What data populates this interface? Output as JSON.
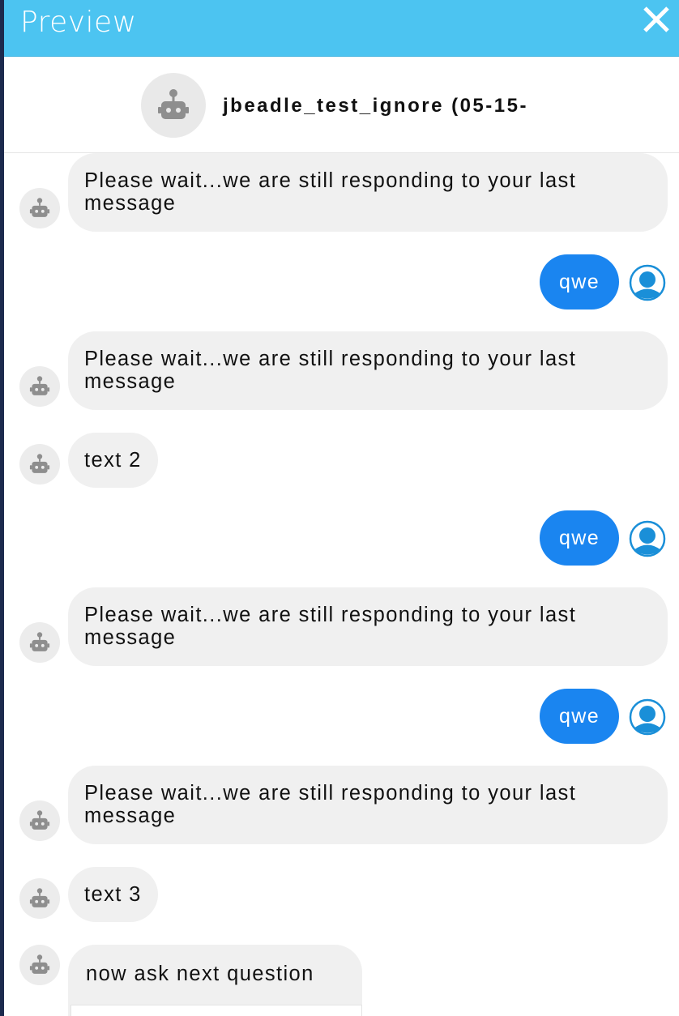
{
  "header": {
    "title": "Preview",
    "close_icon": "close-icon"
  },
  "bot": {
    "name": "jbeadle_test_ignore (05-15-",
    "avatar_icon": "robot-icon"
  },
  "colors": {
    "header_bg": "#4cc4f1",
    "user_bubble": "#1a85f0",
    "bot_bubble": "#f0f0f0",
    "user_avatar": "#1a8fd8"
  },
  "messages": [
    {
      "sender": "bot",
      "text": "Please wait...we are still responding to your last message"
    },
    {
      "sender": "user",
      "text": "qwe"
    },
    {
      "sender": "bot",
      "text": "Please wait...we are still responding to your last message"
    },
    {
      "sender": "bot",
      "text": "text 2"
    },
    {
      "sender": "user",
      "text": "qwe"
    },
    {
      "sender": "bot",
      "text": "Please wait...we are still responding to your last message"
    },
    {
      "sender": "user",
      "text": "qwe"
    },
    {
      "sender": "bot",
      "text": "Please wait...we are still responding to your last message"
    },
    {
      "sender": "bot",
      "text": "text 3"
    },
    {
      "sender": "bot",
      "text": "now ask next question"
    }
  ]
}
